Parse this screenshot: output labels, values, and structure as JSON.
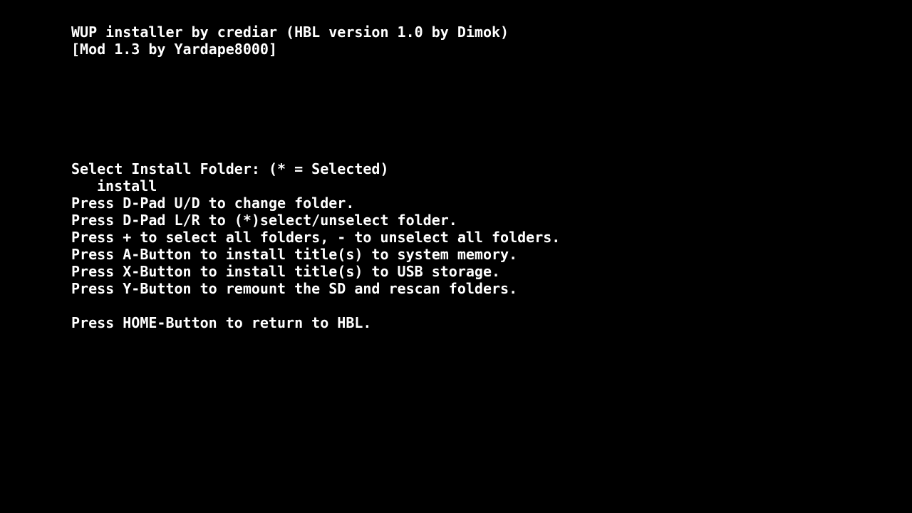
{
  "header": {
    "title_line": "WUP installer by crediar (HBL version 1.0 by Dimok)",
    "mod_line": "[Mod 1.3 by Yardape8000]"
  },
  "folder_select": {
    "heading": "Select Install Folder: (* = Selected)",
    "folders": [
      {
        "name": "install",
        "selected": false
      }
    ]
  },
  "instructions": [
    "Press D-Pad U/D to change folder.",
    "Press D-Pad L/R to (*)select/unselect folder.",
    "Press + to select all folders, - to unselect all folders.",
    "Press A-Button to install title(s) to system memory.",
    "Press X-Button to install title(s) to USB storage.",
    "Press Y-Button to remount the SD and rescan folders."
  ],
  "footer": {
    "home_instruction": "Press HOME-Button to return to HBL."
  },
  "colors": {
    "background": "#000000",
    "text": "#ffffff"
  }
}
